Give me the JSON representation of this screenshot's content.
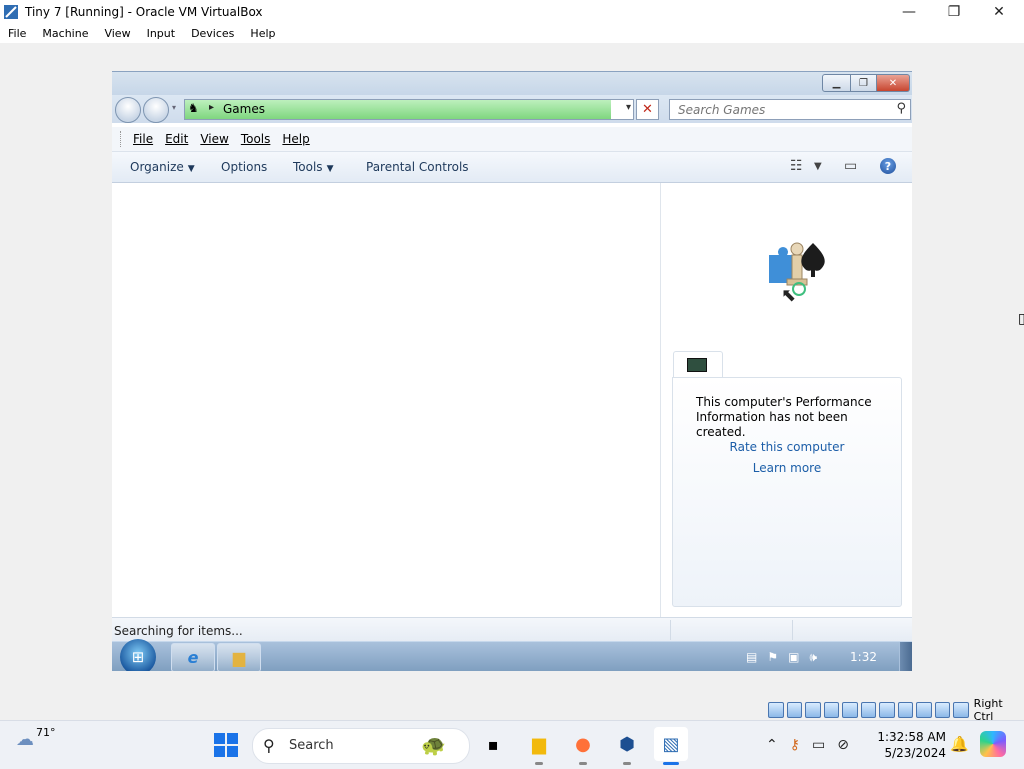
{
  "host_window": {
    "title": "Tiny 7 [Running] - Oracle VM VirtualBox",
    "minimize": "—",
    "restore": "❐",
    "close": "✕",
    "menu": [
      "File",
      "Machine",
      "View",
      "Input",
      "Devices",
      "Help"
    ]
  },
  "guest_explorer": {
    "address": {
      "breadcrumb": "Games",
      "arrow": "▸",
      "dropdown": "▾"
    },
    "stop_glyph": "✕",
    "search_placeholder": "Search Games",
    "menu": [
      "File",
      "Edit",
      "View",
      "Tools",
      "Help"
    ],
    "commands": {
      "organize": "Organize",
      "options": "Options",
      "tools": "Tools",
      "parental_controls": "Parental Controls",
      "caret": "▼"
    },
    "help_glyph": "?",
    "preview": {
      "perf_message": "This computer's Performance Information has not been created.",
      "rate_link": "Rate this computer",
      "learn_link": "Learn more"
    },
    "status_text": "Searching for items..."
  },
  "guest_taskbar": {
    "clock": "1:32"
  },
  "vbox_status": {
    "host_key": "Right Ctrl"
  },
  "host_taskbar": {
    "weather_temp": "71°",
    "search_label": "Search",
    "clock_time": "1:32:58 AM",
    "clock_date": "5/23/2024"
  },
  "colors": {
    "address_progress": "#7fd67f",
    "link_blue": "#1c5ea8",
    "win_accent": "#1a73e8"
  }
}
